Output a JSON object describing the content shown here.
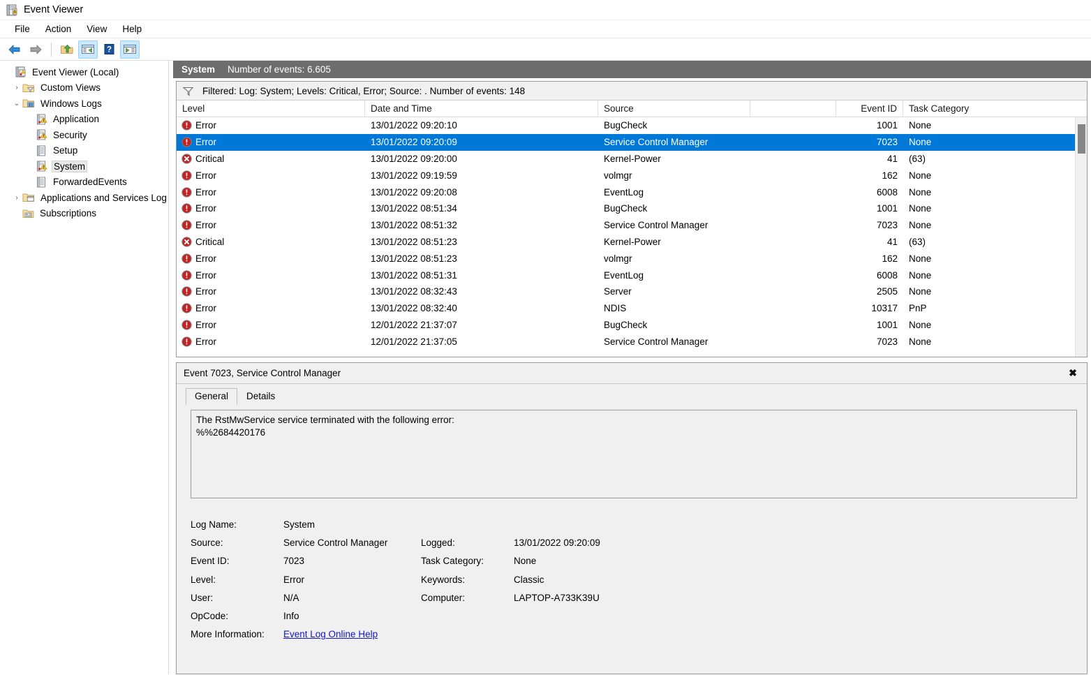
{
  "window": {
    "title": "Event Viewer",
    "icon": "event-viewer-icon"
  },
  "menubar": {
    "items": [
      {
        "label": "File",
        "name": "menu-file"
      },
      {
        "label": "Action",
        "name": "menu-action"
      },
      {
        "label": "View",
        "name": "menu-view"
      },
      {
        "label": "Help",
        "name": "menu-help"
      }
    ]
  },
  "toolbar": {
    "buttons": [
      {
        "name": "back-button",
        "icon": "left-arrow-icon",
        "toggled": false
      },
      {
        "name": "forward-button",
        "icon": "right-arrow-icon",
        "toggled": false
      },
      {
        "name": "up-one-level-button",
        "icon": "folder-up-icon",
        "toggled": false
      },
      {
        "name": "show-console-tree-button",
        "icon": "console-tree-icon",
        "toggled": true
      },
      {
        "name": "help-button",
        "icon": "question-mark-icon",
        "toggled": false
      },
      {
        "name": "show-action-pane-button",
        "icon": "action-pane-icon",
        "toggled": true
      }
    ]
  },
  "sidebar": {
    "items": [
      {
        "label": "Event Viewer (Local)",
        "indent": 0,
        "twisty": "",
        "icon": "event-viewer-icon",
        "selected": false
      },
      {
        "label": "Custom Views",
        "indent": 1,
        "twisty": "collapsed",
        "icon": "custom-views-folder-icon",
        "selected": false
      },
      {
        "label": "Windows Logs",
        "indent": 1,
        "twisty": "expanded",
        "icon": "windows-logs-folder-icon",
        "selected": false
      },
      {
        "label": "Application",
        "indent": 2,
        "twisty": "",
        "icon": "log-warning-icon",
        "selected": false
      },
      {
        "label": "Security",
        "indent": 2,
        "twisty": "",
        "icon": "log-warning-icon",
        "selected": false
      },
      {
        "label": "Setup",
        "indent": 2,
        "twisty": "",
        "icon": "log-plain-icon",
        "selected": false
      },
      {
        "label": "System",
        "indent": 2,
        "twisty": "",
        "icon": "log-warning-icon",
        "selected": true
      },
      {
        "label": "ForwardedEvents",
        "indent": 2,
        "twisty": "",
        "icon": "log-plain-icon",
        "selected": false
      },
      {
        "label": "Applications and Services Log",
        "indent": 1,
        "twisty": "collapsed",
        "icon": "app-services-folder-icon",
        "selected": false
      },
      {
        "label": "Subscriptions",
        "indent": 1,
        "twisty": "",
        "icon": "subscriptions-icon",
        "selected": false
      }
    ]
  },
  "log_header": {
    "log_name": "System",
    "event_count": "Number of events: 6.605"
  },
  "filter_bar": {
    "icon": "filter-funnel-icon",
    "text": "Filtered: Log: System; Levels: Critical, Error; Source: . Number of events: 148"
  },
  "events_table": {
    "columns": [
      "Level",
      "Date and Time",
      "Source",
      "Event ID",
      "Task Category"
    ],
    "rows": [
      {
        "level": "Error",
        "level_icon": "error-icon",
        "datetime": "13/01/2022 09:20:10",
        "source": "BugCheck",
        "event_id": "1001",
        "task_category": "None",
        "selected": false
      },
      {
        "level": "Error",
        "level_icon": "error-icon",
        "datetime": "13/01/2022 09:20:09",
        "source": "Service Control Manager",
        "event_id": "7023",
        "task_category": "None",
        "selected": true
      },
      {
        "level": "Critical",
        "level_icon": "critical-icon",
        "datetime": "13/01/2022 09:20:00",
        "source": "Kernel-Power",
        "event_id": "41",
        "task_category": "(63)",
        "selected": false
      },
      {
        "level": "Error",
        "level_icon": "error-icon",
        "datetime": "13/01/2022 09:19:59",
        "source": "volmgr",
        "event_id": "162",
        "task_category": "None",
        "selected": false
      },
      {
        "level": "Error",
        "level_icon": "error-icon",
        "datetime": "13/01/2022 09:20:08",
        "source": "EventLog",
        "event_id": "6008",
        "task_category": "None",
        "selected": false
      },
      {
        "level": "Error",
        "level_icon": "error-icon",
        "datetime": "13/01/2022 08:51:34",
        "source": "BugCheck",
        "event_id": "1001",
        "task_category": "None",
        "selected": false
      },
      {
        "level": "Error",
        "level_icon": "error-icon",
        "datetime": "13/01/2022 08:51:32",
        "source": "Service Control Manager",
        "event_id": "7023",
        "task_category": "None",
        "selected": false
      },
      {
        "level": "Critical",
        "level_icon": "critical-icon",
        "datetime": "13/01/2022 08:51:23",
        "source": "Kernel-Power",
        "event_id": "41",
        "task_category": "(63)",
        "selected": false
      },
      {
        "level": "Error",
        "level_icon": "error-icon",
        "datetime": "13/01/2022 08:51:23",
        "source": "volmgr",
        "event_id": "162",
        "task_category": "None",
        "selected": false
      },
      {
        "level": "Error",
        "level_icon": "error-icon",
        "datetime": "13/01/2022 08:51:31",
        "source": "EventLog",
        "event_id": "6008",
        "task_category": "None",
        "selected": false
      },
      {
        "level": "Error",
        "level_icon": "error-icon",
        "datetime": "13/01/2022 08:32:43",
        "source": "Server",
        "event_id": "2505",
        "task_category": "None",
        "selected": false
      },
      {
        "level": "Error",
        "level_icon": "error-icon",
        "datetime": "13/01/2022 08:32:40",
        "source": "NDIS",
        "event_id": "10317",
        "task_category": "PnP",
        "selected": false
      },
      {
        "level": "Error",
        "level_icon": "error-icon",
        "datetime": "12/01/2022 21:37:07",
        "source": "BugCheck",
        "event_id": "1001",
        "task_category": "None",
        "selected": false
      },
      {
        "level": "Error",
        "level_icon": "error-icon",
        "datetime": "12/01/2022 21:37:05",
        "source": "Service Control Manager",
        "event_id": "7023",
        "task_category": "None",
        "selected": false
      }
    ]
  },
  "detail_panel": {
    "title": "Event 7023, Service Control Manager",
    "close_label": "✖",
    "tabs": [
      {
        "label": "General",
        "active": true
      },
      {
        "label": "Details",
        "active": false
      }
    ],
    "message": "The RstMwService service terminated with the following error:\n%%2684420176",
    "fields_left": [
      {
        "label": "Log Name:",
        "value": "System"
      },
      {
        "label": "Source:",
        "value": "Service Control Manager"
      },
      {
        "label": "Event ID:",
        "value": "7023"
      },
      {
        "label": "Level:",
        "value": "Error"
      },
      {
        "label": "User:",
        "value": "N/A"
      },
      {
        "label": "OpCode:",
        "value": "Info"
      }
    ],
    "fields_right": [
      {
        "label": "Logged:",
        "value": "13/01/2022 09:20:09"
      },
      {
        "label": "Task Category:",
        "value": "None"
      },
      {
        "label": "Keywords:",
        "value": "Classic"
      },
      {
        "label": "Computer:",
        "value": "LAPTOP-A733K39U"
      }
    ],
    "more_info_label": "More Information:",
    "more_info_link": "Event Log Online Help"
  },
  "colors": {
    "selection_blue": "#0078d7",
    "log_header_gray": "#6d6d6d",
    "error_red": "#cc1111",
    "link_blue": "#1414cf"
  }
}
